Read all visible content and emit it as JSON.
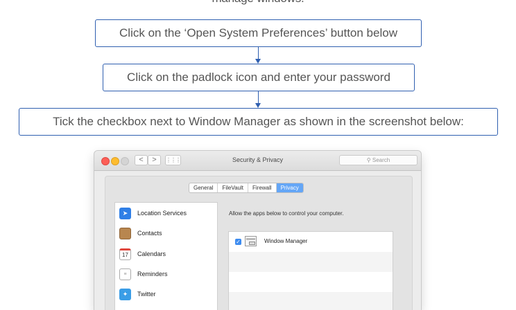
{
  "instructions": {
    "top_partial": "manage windows.",
    "step1": "Click on the ‘Open System Preferences’ button below",
    "step2": "Click on the padlock icon and enter your password",
    "step3": "Tick the checkbox next to Window Manager as shown in the screenshot below:"
  },
  "window": {
    "title": "Security & Privacy",
    "search_placeholder": "Search",
    "nav_back": "<",
    "nav_forward": ">",
    "grid": "⋮⋮⋮",
    "tabs": [
      "General",
      "FileVault",
      "Firewall",
      "Privacy"
    ],
    "active_tab": "Privacy",
    "sidebar": [
      {
        "label": "Location Services",
        "icon": "location-arrow-icon",
        "color": "#2f7fe6"
      },
      {
        "label": "Contacts",
        "icon": "contacts-book-icon",
        "color": "#b8864f"
      },
      {
        "label": "Calendars",
        "icon": "calendar-icon",
        "color": "#ffffff",
        "glyph": "17"
      },
      {
        "label": "Reminders",
        "icon": "reminders-list-icon",
        "color": "#ffffff"
      },
      {
        "label": "Twitter",
        "icon": "twitter-bird-icon",
        "color": "#3a9de6"
      }
    ],
    "description": "Allow the apps below to control your computer.",
    "apps": [
      {
        "name": "Window Manager",
        "checked": true
      }
    ]
  },
  "colors": {
    "accent": "#2f5fb0",
    "tab_active": "#64a6f6",
    "checkbox": "#3d8cf0"
  }
}
